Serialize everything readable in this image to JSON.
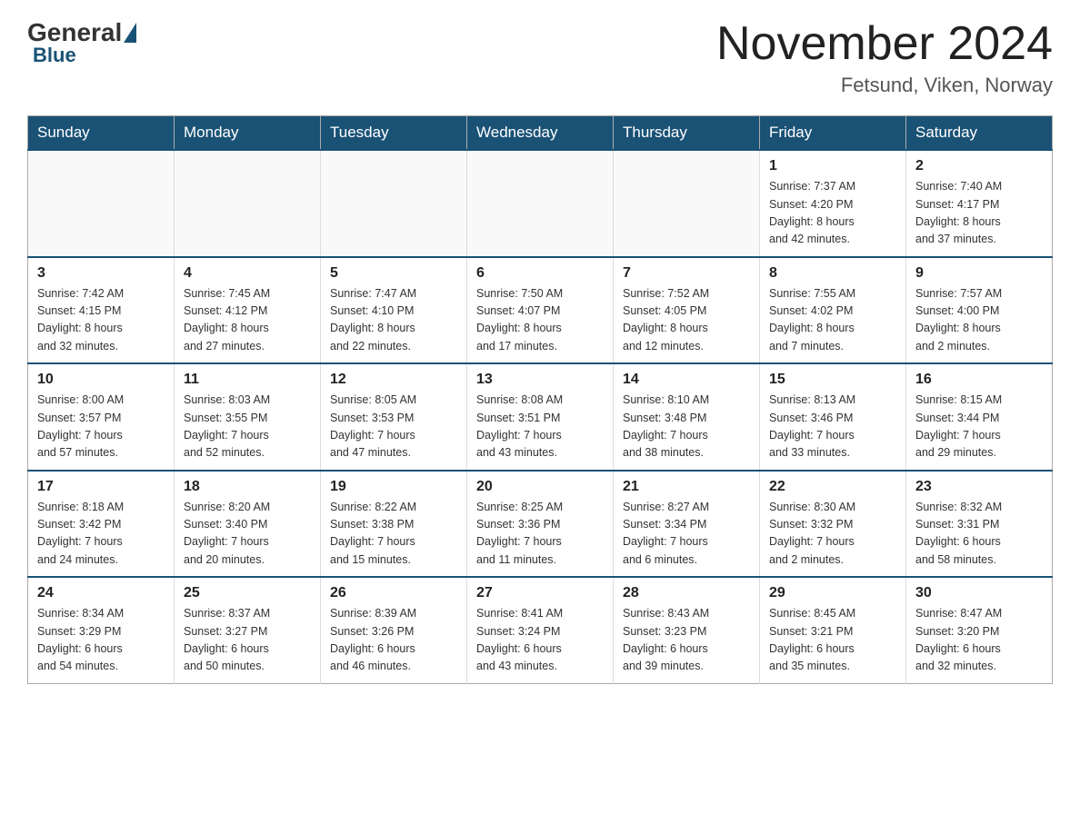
{
  "header": {
    "logo": {
      "general": "General",
      "blue": "Blue"
    },
    "title": "November 2024",
    "subtitle": "Fetsund, Viken, Norway"
  },
  "calendar": {
    "weekdays": [
      "Sunday",
      "Monday",
      "Tuesday",
      "Wednesday",
      "Thursday",
      "Friday",
      "Saturday"
    ],
    "weeks": [
      [
        {
          "day": "",
          "info": ""
        },
        {
          "day": "",
          "info": ""
        },
        {
          "day": "",
          "info": ""
        },
        {
          "day": "",
          "info": ""
        },
        {
          "day": "",
          "info": ""
        },
        {
          "day": "1",
          "info": "Sunrise: 7:37 AM\nSunset: 4:20 PM\nDaylight: 8 hours\nand 42 minutes."
        },
        {
          "day": "2",
          "info": "Sunrise: 7:40 AM\nSunset: 4:17 PM\nDaylight: 8 hours\nand 37 minutes."
        }
      ],
      [
        {
          "day": "3",
          "info": "Sunrise: 7:42 AM\nSunset: 4:15 PM\nDaylight: 8 hours\nand 32 minutes."
        },
        {
          "day": "4",
          "info": "Sunrise: 7:45 AM\nSunset: 4:12 PM\nDaylight: 8 hours\nand 27 minutes."
        },
        {
          "day": "5",
          "info": "Sunrise: 7:47 AM\nSunset: 4:10 PM\nDaylight: 8 hours\nand 22 minutes."
        },
        {
          "day": "6",
          "info": "Sunrise: 7:50 AM\nSunset: 4:07 PM\nDaylight: 8 hours\nand 17 minutes."
        },
        {
          "day": "7",
          "info": "Sunrise: 7:52 AM\nSunset: 4:05 PM\nDaylight: 8 hours\nand 12 minutes."
        },
        {
          "day": "8",
          "info": "Sunrise: 7:55 AM\nSunset: 4:02 PM\nDaylight: 8 hours\nand 7 minutes."
        },
        {
          "day": "9",
          "info": "Sunrise: 7:57 AM\nSunset: 4:00 PM\nDaylight: 8 hours\nand 2 minutes."
        }
      ],
      [
        {
          "day": "10",
          "info": "Sunrise: 8:00 AM\nSunset: 3:57 PM\nDaylight: 7 hours\nand 57 minutes."
        },
        {
          "day": "11",
          "info": "Sunrise: 8:03 AM\nSunset: 3:55 PM\nDaylight: 7 hours\nand 52 minutes."
        },
        {
          "day": "12",
          "info": "Sunrise: 8:05 AM\nSunset: 3:53 PM\nDaylight: 7 hours\nand 47 minutes."
        },
        {
          "day": "13",
          "info": "Sunrise: 8:08 AM\nSunset: 3:51 PM\nDaylight: 7 hours\nand 43 minutes."
        },
        {
          "day": "14",
          "info": "Sunrise: 8:10 AM\nSunset: 3:48 PM\nDaylight: 7 hours\nand 38 minutes."
        },
        {
          "day": "15",
          "info": "Sunrise: 8:13 AM\nSunset: 3:46 PM\nDaylight: 7 hours\nand 33 minutes."
        },
        {
          "day": "16",
          "info": "Sunrise: 8:15 AM\nSunset: 3:44 PM\nDaylight: 7 hours\nand 29 minutes."
        }
      ],
      [
        {
          "day": "17",
          "info": "Sunrise: 8:18 AM\nSunset: 3:42 PM\nDaylight: 7 hours\nand 24 minutes."
        },
        {
          "day": "18",
          "info": "Sunrise: 8:20 AM\nSunset: 3:40 PM\nDaylight: 7 hours\nand 20 minutes."
        },
        {
          "day": "19",
          "info": "Sunrise: 8:22 AM\nSunset: 3:38 PM\nDaylight: 7 hours\nand 15 minutes."
        },
        {
          "day": "20",
          "info": "Sunrise: 8:25 AM\nSunset: 3:36 PM\nDaylight: 7 hours\nand 11 minutes."
        },
        {
          "day": "21",
          "info": "Sunrise: 8:27 AM\nSunset: 3:34 PM\nDaylight: 7 hours\nand 6 minutes."
        },
        {
          "day": "22",
          "info": "Sunrise: 8:30 AM\nSunset: 3:32 PM\nDaylight: 7 hours\nand 2 minutes."
        },
        {
          "day": "23",
          "info": "Sunrise: 8:32 AM\nSunset: 3:31 PM\nDaylight: 6 hours\nand 58 minutes."
        }
      ],
      [
        {
          "day": "24",
          "info": "Sunrise: 8:34 AM\nSunset: 3:29 PM\nDaylight: 6 hours\nand 54 minutes."
        },
        {
          "day": "25",
          "info": "Sunrise: 8:37 AM\nSunset: 3:27 PM\nDaylight: 6 hours\nand 50 minutes."
        },
        {
          "day": "26",
          "info": "Sunrise: 8:39 AM\nSunset: 3:26 PM\nDaylight: 6 hours\nand 46 minutes."
        },
        {
          "day": "27",
          "info": "Sunrise: 8:41 AM\nSunset: 3:24 PM\nDaylight: 6 hours\nand 43 minutes."
        },
        {
          "day": "28",
          "info": "Sunrise: 8:43 AM\nSunset: 3:23 PM\nDaylight: 6 hours\nand 39 minutes."
        },
        {
          "day": "29",
          "info": "Sunrise: 8:45 AM\nSunset: 3:21 PM\nDaylight: 6 hours\nand 35 minutes."
        },
        {
          "day": "30",
          "info": "Sunrise: 8:47 AM\nSunset: 3:20 PM\nDaylight: 6 hours\nand 32 minutes."
        }
      ]
    ]
  }
}
